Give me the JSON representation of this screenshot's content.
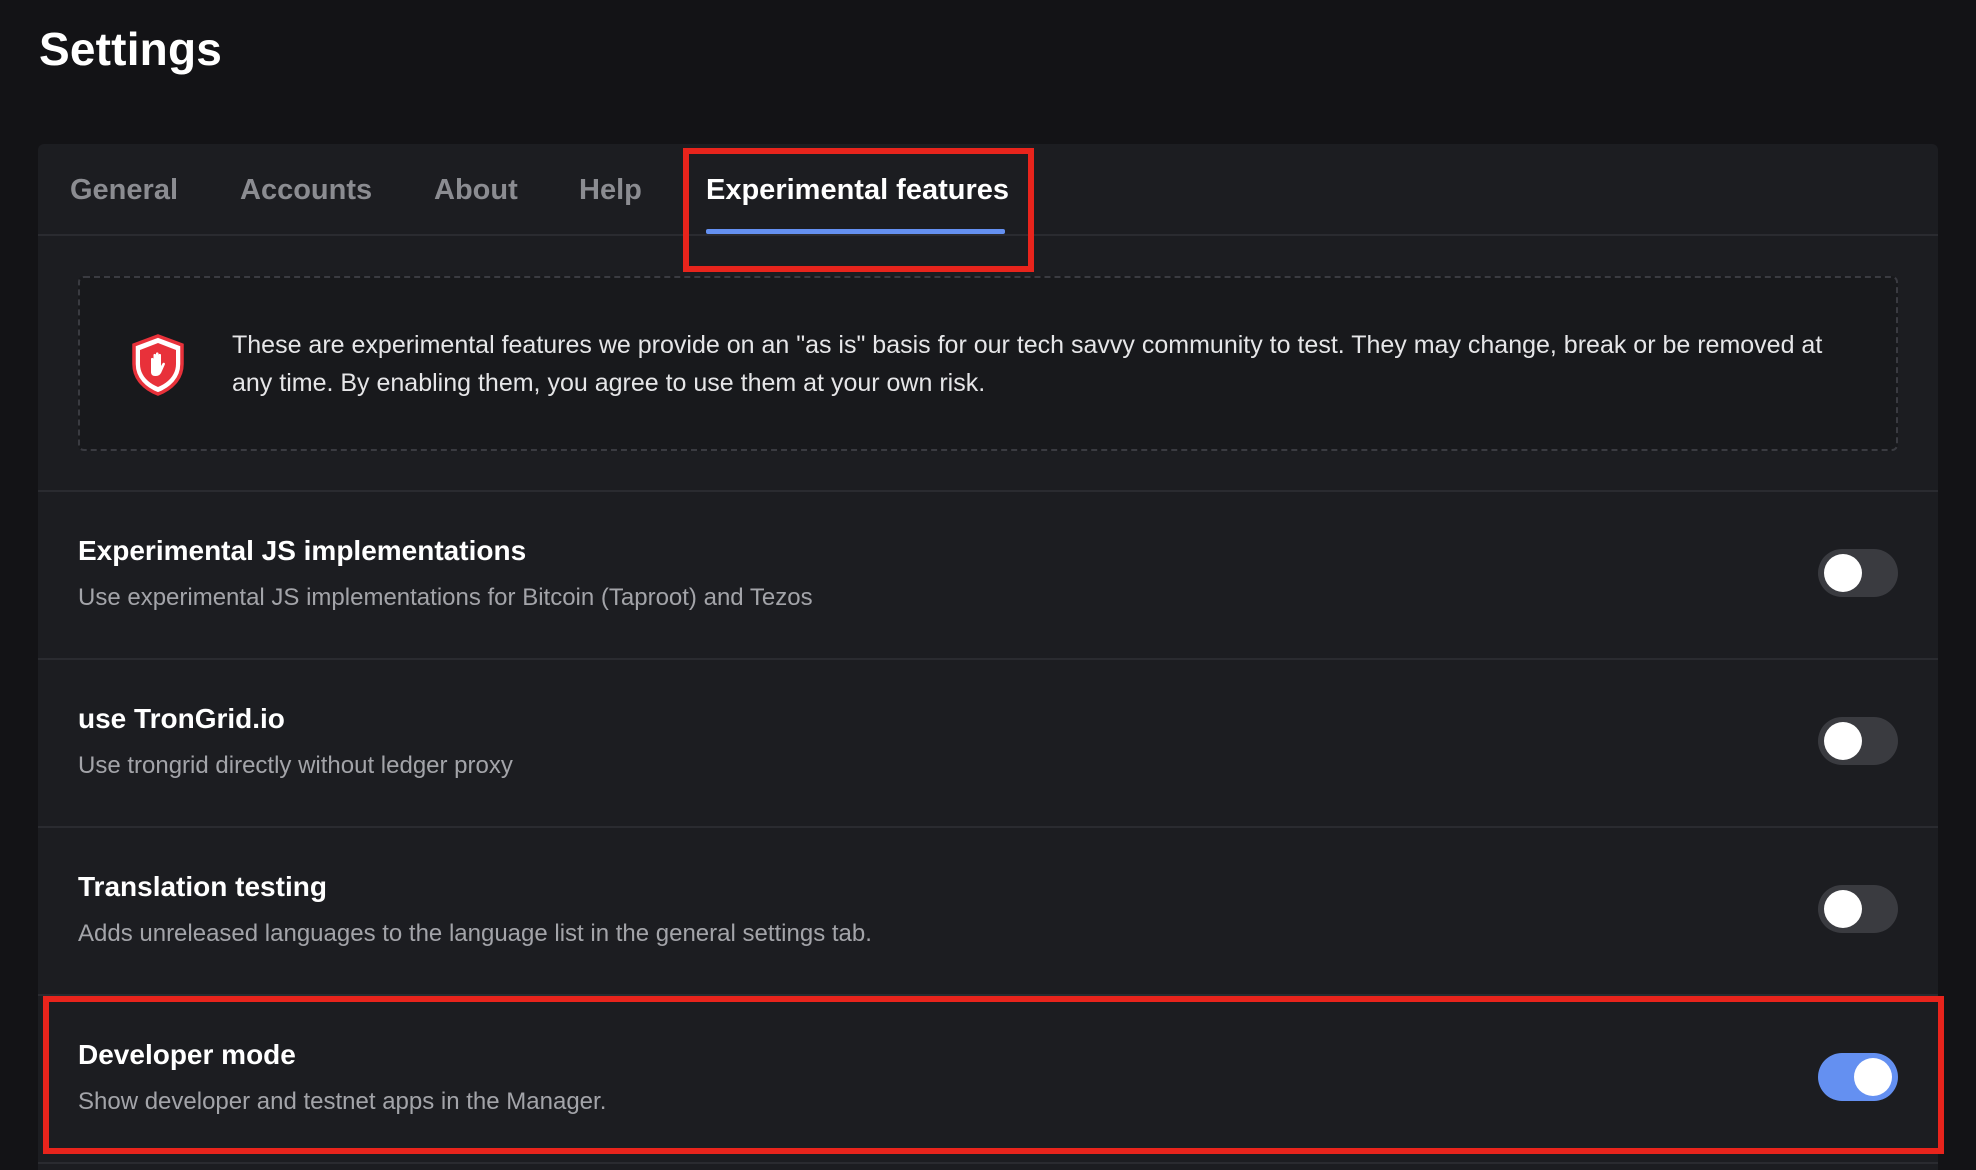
{
  "page": {
    "title": "Settings"
  },
  "tabs": [
    {
      "label": "General",
      "active": false
    },
    {
      "label": "Accounts",
      "active": false
    },
    {
      "label": "About",
      "active": false
    },
    {
      "label": "Help",
      "active": false
    },
    {
      "label": "Experimental features",
      "active": true
    }
  ],
  "notice": {
    "icon": "shield-hand-icon",
    "text": "These are experimental features we provide on an \"as is\" basis for our tech savvy community to test. They may change, break or be removed at any time. By enabling them, you agree to use them at your own risk."
  },
  "settings": [
    {
      "title": "Experimental JS implementations",
      "description": "Use experimental JS implementations for Bitcoin (Taproot) and Tezos",
      "enabled": false
    },
    {
      "title": "use TronGrid.io",
      "description": "Use trongrid directly without ledger proxy",
      "enabled": false
    },
    {
      "title": "Translation testing",
      "description": "Adds unreleased languages to the language list in the general settings tab.",
      "enabled": false
    },
    {
      "title": "Developer mode",
      "description": "Show developer and testnet apps in the Manager.",
      "enabled": true
    }
  ],
  "colors": {
    "background": "#131316",
    "panel": "#1c1d21",
    "accent": "#6490f1",
    "highlight": "#e8241c",
    "shield": "#e8313a"
  }
}
